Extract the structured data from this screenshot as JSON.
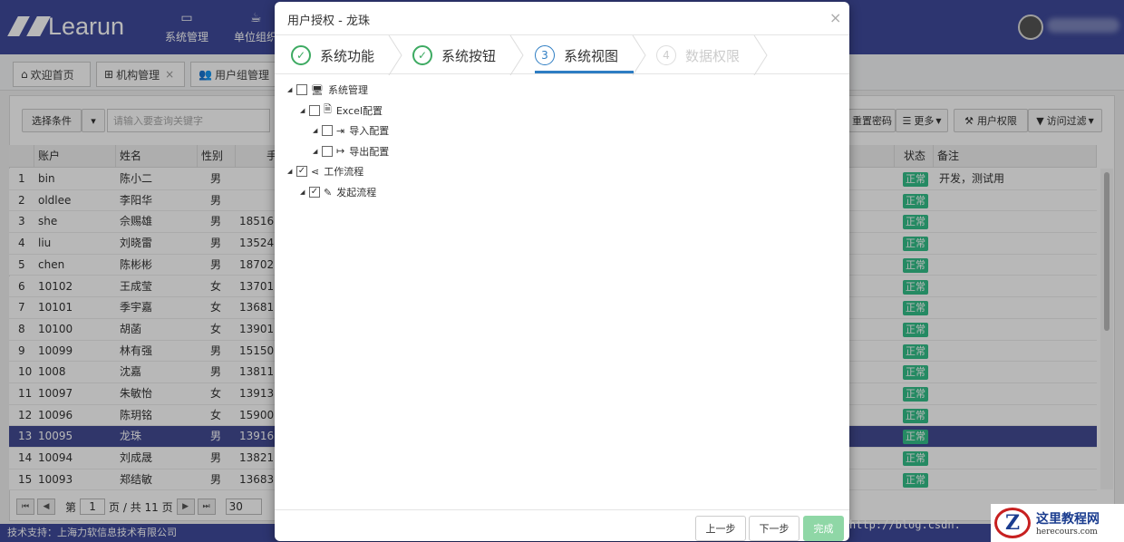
{
  "app": {
    "logo_text": "Learun"
  },
  "topnav": [
    {
      "label": "系统管理",
      "icon": "monitor-icon"
    },
    {
      "label": "单位组织",
      "icon": "coffee-icon"
    }
  ],
  "tabs": [
    {
      "label": "欢迎首页",
      "icon": "home-icon"
    },
    {
      "label": "机构管理",
      "icon": "sitemap-icon",
      "close": "×"
    },
    {
      "label": "用户组管理",
      "icon": "users-icon"
    }
  ],
  "tab_controls": [
    "‹",
    "›",
    "⤢",
    "⚙"
  ],
  "toolbar": {
    "condition_label": "选择条件",
    "caret": "▾",
    "search_placeholder": "请输入要查询关键字",
    "reset_pwd": "重置密码",
    "more": "更多",
    "user_perm": "用户权限",
    "access_filter": "访问过滤"
  },
  "grid": {
    "headers": [
      "账户",
      "姓名",
      "性别",
      "手",
      "状态",
      "备注"
    ],
    "rows": [
      {
        "n": "1",
        "acct": "bin",
        "name": "陈小二",
        "sex": "男",
        "phone": "",
        "status": "正常",
        "note": "开发，测试用"
      },
      {
        "n": "2",
        "acct": "oldlee",
        "name": "李阳华",
        "sex": "男",
        "phone": "",
        "status": "正常",
        "note": ""
      },
      {
        "n": "3",
        "acct": "she",
        "name": "佘赐雄",
        "sex": "男",
        "phone": "18516",
        "status": "正常",
        "note": ""
      },
      {
        "n": "4",
        "acct": "liu",
        "name": "刘晓雷",
        "sex": "男",
        "phone": "13524",
        "status": "正常",
        "note": ""
      },
      {
        "n": "5",
        "acct": "chen",
        "name": "陈彬彬",
        "sex": "男",
        "phone": "18702",
        "status": "正常",
        "note": ""
      },
      {
        "n": "6",
        "acct": "10102",
        "name": "王成莹",
        "sex": "女",
        "phone": "13701",
        "status": "正常",
        "note": ""
      },
      {
        "n": "7",
        "acct": "10101",
        "name": "季宇嘉",
        "sex": "女",
        "phone": "13681",
        "status": "正常",
        "note": ""
      },
      {
        "n": "8",
        "acct": "10100",
        "name": "胡菡",
        "sex": "女",
        "phone": "13901",
        "status": "正常",
        "note": ""
      },
      {
        "n": "9",
        "acct": "10099",
        "name": "林有强",
        "sex": "男",
        "phone": "15150",
        "status": "正常",
        "note": ""
      },
      {
        "n": "10",
        "acct": "1008",
        "name": "沈嘉",
        "sex": "男",
        "phone": "13811",
        "status": "正常",
        "note": ""
      },
      {
        "n": "11",
        "acct": "10097",
        "name": "朱敏怡",
        "sex": "女",
        "phone": "13913",
        "status": "正常",
        "note": ""
      },
      {
        "n": "12",
        "acct": "10096",
        "name": "陈玥铭",
        "sex": "女",
        "phone": "15900",
        "status": "正常",
        "note": ""
      },
      {
        "n": "13",
        "acct": "10095",
        "name": "龙珠",
        "sex": "男",
        "phone": "13916",
        "status": "正常",
        "note": "",
        "selected": true
      },
      {
        "n": "14",
        "acct": "10094",
        "name": "刘成晟",
        "sex": "男",
        "phone": "13821",
        "status": "正常",
        "note": ""
      },
      {
        "n": "15",
        "acct": "10093",
        "name": "郑结敏",
        "sex": "男",
        "phone": "13683",
        "status": "正常",
        "note": ""
      }
    ]
  },
  "pager": {
    "first": "⏮",
    "prev": "◀",
    "page_prefix": "第",
    "page": "1",
    "page_suffix": "页 / 共 11 页",
    "next": "▶",
    "last": "⏭",
    "page_size": "30"
  },
  "footer": "技术支持：上海力软信息技术有限公司",
  "dialog": {
    "title": "用户授权 - 龙珠",
    "close": "×",
    "steps": [
      {
        "num": "✓",
        "label": "系统功能",
        "state": "done"
      },
      {
        "num": "✓",
        "label": "系统按钮",
        "state": "done"
      },
      {
        "num": "3",
        "label": "系统视图",
        "state": "active"
      },
      {
        "num": "4",
        "label": "数据权限",
        "state": "todo"
      }
    ],
    "tree": [
      {
        "label": "系统管理",
        "icon": "monitor-icon",
        "glyph": "🖥",
        "checked": false,
        "level": 0
      },
      {
        "label": "Excel配置",
        "icon": "file-excel-icon",
        "glyph": "🗎",
        "checked": false,
        "level": 1
      },
      {
        "label": "导入配置",
        "icon": "sign-in-icon",
        "glyph": "⇥",
        "checked": false,
        "level": 2
      },
      {
        "label": "导出配置",
        "icon": "sign-out-icon",
        "glyph": "↦",
        "checked": false,
        "level": 2
      },
      {
        "label": "工作流程",
        "icon": "share-alt-icon",
        "glyph": "⋖",
        "checked": true,
        "level": 0
      },
      {
        "label": "发起流程",
        "icon": "edit-icon",
        "glyph": "✎",
        "checked": true,
        "level": 1
      }
    ],
    "buttons": {
      "prev": "上一步",
      "next": "下一步",
      "finish": "完成"
    }
  },
  "watermark": {
    "url": "http://blog.csdn.",
    "site_cn": "这里教程网",
    "site_en": "herecours.com",
    "logo_letter": "Z"
  }
}
